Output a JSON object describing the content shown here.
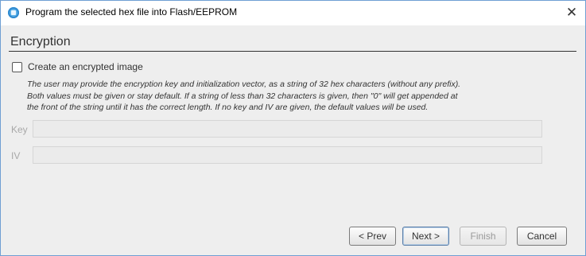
{
  "window": {
    "title": "Program the selected hex file into Flash/EEPROM",
    "close_glyph": "✕"
  },
  "section": {
    "title": "Encryption"
  },
  "checkbox": {
    "label": "Create an encrypted image",
    "checked": false
  },
  "description": {
    "line1": "The user may provide the encryption key and initialization vector, as a string of 32 hex characters (without any prefix).",
    "line2": "Both values must be given or stay default. If a string of less than 32 characters is given, then \"0\" will get appended at",
    "line3": "the front of the string until it has the correct length. If no key and IV are given, the default values will be used."
  },
  "fields": {
    "key_label": "Key",
    "key_value": "",
    "iv_label": "IV",
    "iv_value": ""
  },
  "buttons": {
    "prev": "< Prev",
    "next": "Next >",
    "finish": "Finish",
    "cancel": "Cancel"
  },
  "icons": {
    "app": "app-icon",
    "close": "close-icon"
  },
  "colors": {
    "content_bg": "#eeeeee",
    "disabled_text": "#a8a8a8",
    "border": "#6f9fd3"
  }
}
